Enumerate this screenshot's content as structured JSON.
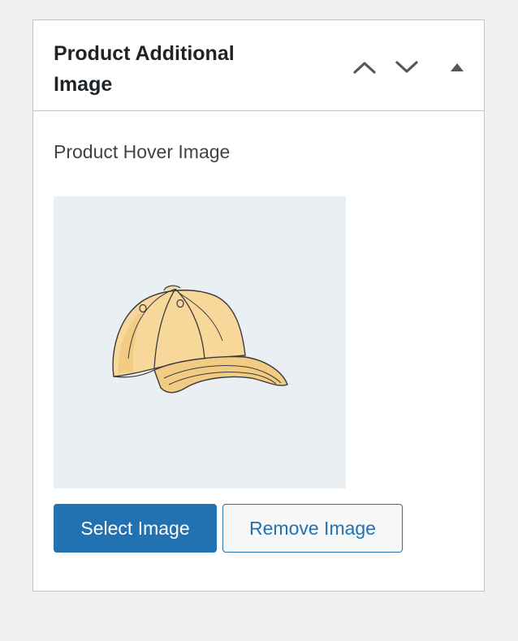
{
  "metabox": {
    "title": "Product Additional Image",
    "controls": {
      "move_up_icon": "chevron-up-icon",
      "move_down_icon": "chevron-down-icon",
      "toggle_icon": "triangle-up-icon"
    }
  },
  "field": {
    "label": "Product Hover Image",
    "image_subject": "baseball-cap-illustration"
  },
  "buttons": {
    "select_label": "Select Image",
    "remove_label": "Remove Image"
  },
  "colors": {
    "primary": "#2271b1",
    "page_background": "#f0f0f1",
    "preview_background": "#eaeff3",
    "cap_fill": "#f7d89a"
  }
}
